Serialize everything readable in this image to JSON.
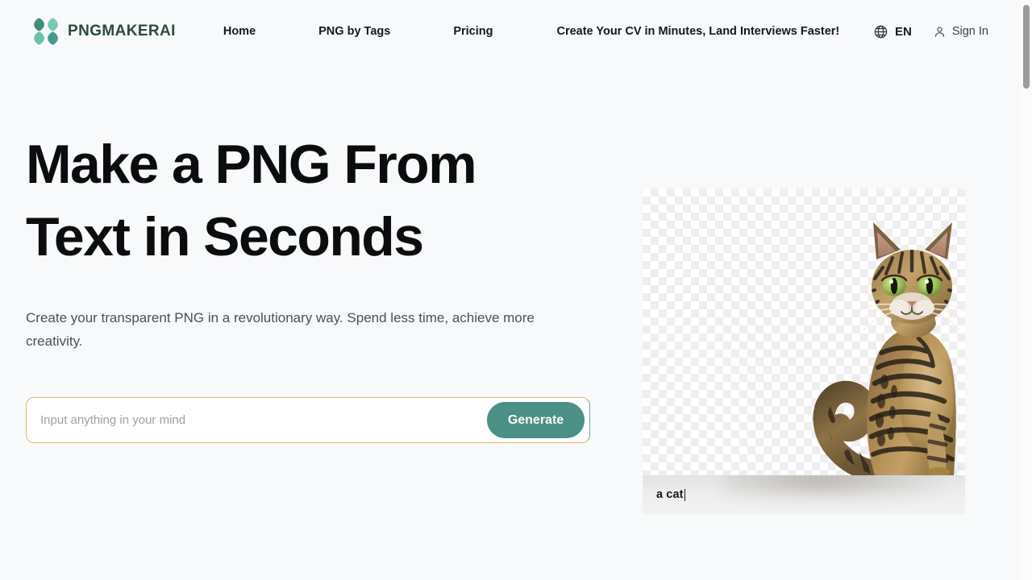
{
  "header": {
    "brand": {
      "name": "PNGMAKERAI",
      "logo_icon": "clover-logo-icon",
      "colors": {
        "petal_dark": "#3f8d7c",
        "petal_light": "#78c9b4",
        "text": "#2b4b40"
      }
    },
    "nav": [
      {
        "label": "Home"
      },
      {
        "label": "PNG by Tags"
      },
      {
        "label": "Pricing"
      },
      {
        "label": "Create Your CV in Minutes, Land Interviews Faster!"
      }
    ],
    "language": {
      "icon": "globe-icon",
      "label": "EN"
    },
    "account": {
      "icon": "user-icon",
      "label": "Sign In"
    }
  },
  "hero": {
    "title_line1": "Make a PNG From",
    "title_line2": "Text in Seconds",
    "subtitle": "Create your transparent PNG in a revolutionary way. Spend less time, achieve more creativity.",
    "prompt": {
      "placeholder": "Input anything in your mind",
      "value": "",
      "button_label": "Generate",
      "button_color": "#4a9085",
      "border_accent": "#ddb66a"
    }
  },
  "preview": {
    "image_alt": "a cat",
    "caption": "a cat",
    "caret": "|",
    "background": "transparency-checkerboard"
  },
  "scrollbar": {
    "position": "top",
    "thumb_color": "#9b9b9b"
  }
}
